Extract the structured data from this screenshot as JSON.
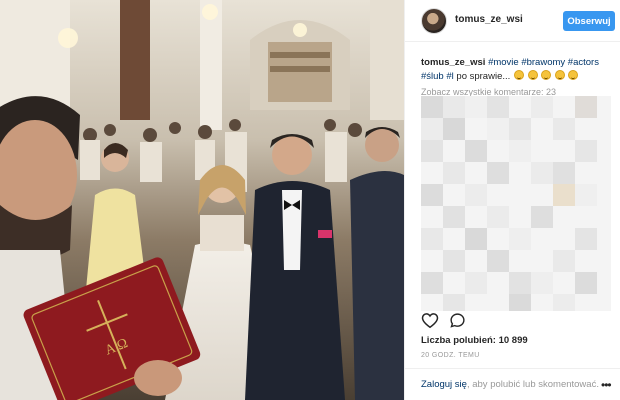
{
  "post": {
    "username": "tomus_ze_wsi",
    "follow_label": "Obserwuj",
    "caption_user": "tomus_ze_wsi",
    "caption_tags": [
      "#movie",
      "#brawomy",
      "#actors",
      "#ślub",
      "#l"
    ],
    "caption_tail": "po sprawie...",
    "caption_emoji_count": 5,
    "view_all_comments": "Zobacz wszystkie komentarze: 23",
    "likes": "Liczba polubień: 10 899",
    "time_ago": "20 GODZ. TEMU",
    "login_link": "Zaloguj się",
    "login_rest": ", aby polubić lub skomentować.",
    "more_options": "•••"
  },
  "photo": {
    "book_symbol": "A Ω"
  },
  "colors": {
    "accent": "#3897f0",
    "link": "#003569",
    "muted": "#999999"
  },
  "icons": [
    "heart-icon",
    "comment-icon",
    "more-options-icon"
  ]
}
